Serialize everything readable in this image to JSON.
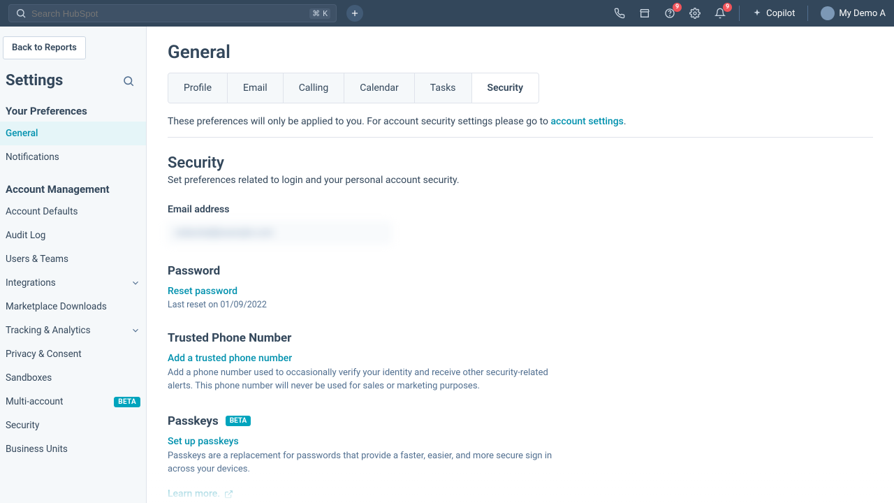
{
  "topnav": {
    "search_placeholder": "Search HubSpot",
    "kbdA": "⌘",
    "kbdB": "K",
    "copilot": "Copilot",
    "account": "My Demo A",
    "badge_help": "9",
    "badge_bell": "9"
  },
  "sidebar": {
    "back": "Back to Reports",
    "title": "Settings",
    "pref_header": "Your Preferences",
    "pref_items": [
      {
        "label": "General",
        "active": true
      },
      {
        "label": "Notifications"
      }
    ],
    "mgmt_header": "Account Management",
    "mgmt_items": [
      {
        "label": "Account Defaults"
      },
      {
        "label": "Audit Log"
      },
      {
        "label": "Users & Teams"
      },
      {
        "label": "Integrations",
        "chevron": true
      },
      {
        "label": "Marketplace Downloads"
      },
      {
        "label": "Tracking & Analytics",
        "chevron": true
      },
      {
        "label": "Privacy & Consent"
      },
      {
        "label": "Sandboxes"
      },
      {
        "label": "Multi-account",
        "beta": true
      },
      {
        "label": "Security"
      },
      {
        "label": "Business Units"
      }
    ],
    "beta_label": "BETA"
  },
  "main": {
    "title": "General",
    "tabs": [
      {
        "label": "Profile"
      },
      {
        "label": "Email"
      },
      {
        "label": "Calling"
      },
      {
        "label": "Calendar"
      },
      {
        "label": "Tasks"
      },
      {
        "label": "Security",
        "active": true
      }
    ],
    "notice_pre": "These preferences will only be applied to you. For account security settings please go to ",
    "notice_link": "account settings",
    "notice_post": ".",
    "security": {
      "title": "Security",
      "desc": "Set preferences related to login and your personal account security.",
      "email_label": "Email address",
      "email_value": "redacted@example.com",
      "password_head": "Password",
      "password_link": "Reset password",
      "password_meta": "Last reset on 01/09/2022",
      "phone_head": "Trusted Phone Number",
      "phone_link": "Add a trusted phone number",
      "phone_desc": "Add a phone number used to occasionally verify your identity and receive other security-related alerts. This phone number will never be used for sales or marketing purposes.",
      "passkeys_head": "Passkeys",
      "passkeys_beta": "BETA",
      "passkeys_link": "Set up passkeys",
      "passkeys_desc": "Passkeys are a replacement for passwords that provide a faster, easier, and more secure sign in across your devices.",
      "learn_more": "Learn more."
    }
  }
}
